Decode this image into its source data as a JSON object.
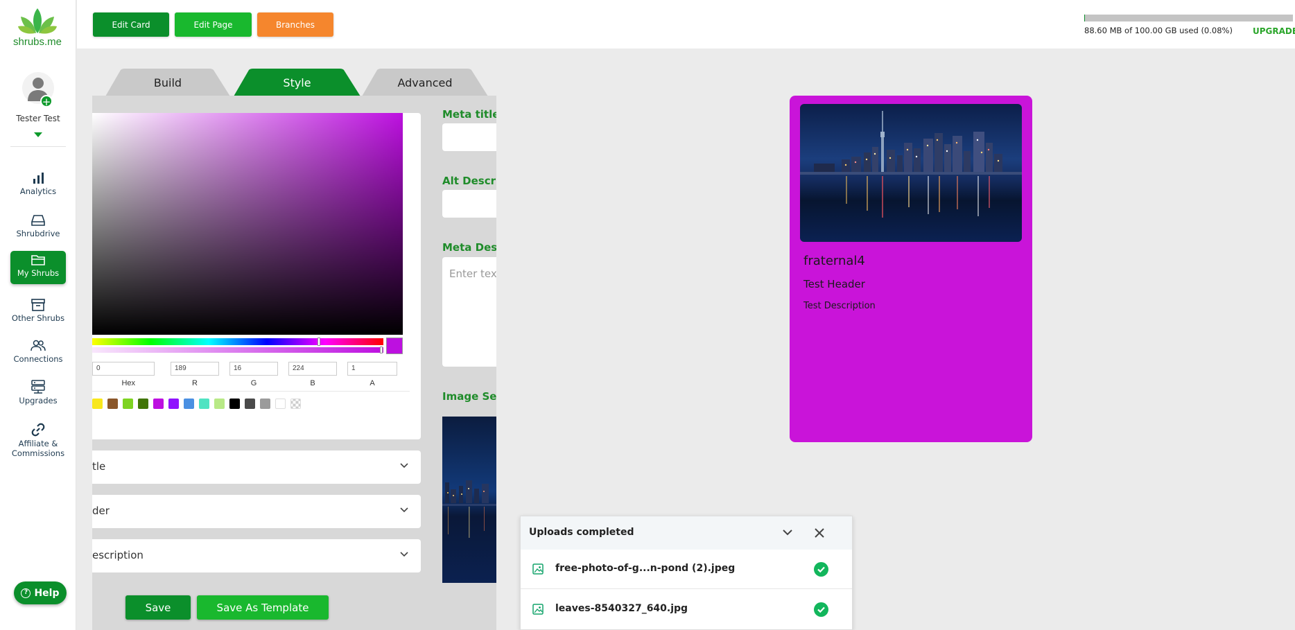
{
  "sidebar": {
    "logo_text": "shrubs.me",
    "user_name": "Tester Test",
    "nav": [
      {
        "label": "Analytics",
        "icon": "bar-chart-icon"
      },
      {
        "label": "Shrubdrive",
        "icon": "drive-icon"
      },
      {
        "label": "My Shrubs",
        "icon": "folder-icon",
        "active": true
      },
      {
        "label": "Other Shrubs",
        "icon": "archive-icon"
      },
      {
        "label": "Connections",
        "icon": "users-icon"
      },
      {
        "label": "Upgrades",
        "icon": "server-icon"
      },
      {
        "label": "Affiliate &",
        "label2": "Commissions",
        "icon": "link-icon"
      }
    ],
    "help_label": "Help"
  },
  "topbar": {
    "edit_card": "Edit Card",
    "edit_page": "Edit Page",
    "branches": "Branches",
    "storage_text": "88.60 MB of 100.00 GB used (0.08%)",
    "storage_fraction": 0.0008,
    "upgrade": "UPGRADE"
  },
  "tabs": {
    "build": "Build",
    "style": "Style",
    "advanced": "Advanced",
    "active": "Style"
  },
  "color_picker": {
    "hex_value": "0",
    "r": "189",
    "g": "16",
    "b": "224",
    "a": "1",
    "labels": {
      "hex": "Hex",
      "r": "R",
      "g": "G",
      "b": "B",
      "a": "A"
    },
    "current_color": "#bd10e0",
    "presets": [
      "#f8e71c",
      "#8b572a",
      "#7ed321",
      "#417505",
      "#bd10e0",
      "#9013fe",
      "#4a90e2",
      "#50e3c2",
      "#b8e986",
      "#000000",
      "#4a4a4a",
      "#9b9b9b",
      "#ffffff",
      "transparent"
    ]
  },
  "accordions": {
    "title": "tle",
    "header": "der",
    "description": "escription"
  },
  "meta": {
    "meta_title": "Meta title",
    "alt_description": "Alt Descrip",
    "meta_description": "Meta Descr",
    "meta_description_placeholder": "Enter text",
    "image_settings": "Image Sett"
  },
  "actions": {
    "save": "Save",
    "save_template": "Save As Template"
  },
  "preview": {
    "title": "fraternal4",
    "header": "Test Header",
    "description": "Test Description",
    "background": "#c914d9"
  },
  "uploads": {
    "title": "Uploads completed",
    "files": [
      {
        "name": "free-photo-of-g...n-pond (2).jpeg"
      },
      {
        "name": "leaves-8540327_640.jpg"
      }
    ]
  }
}
